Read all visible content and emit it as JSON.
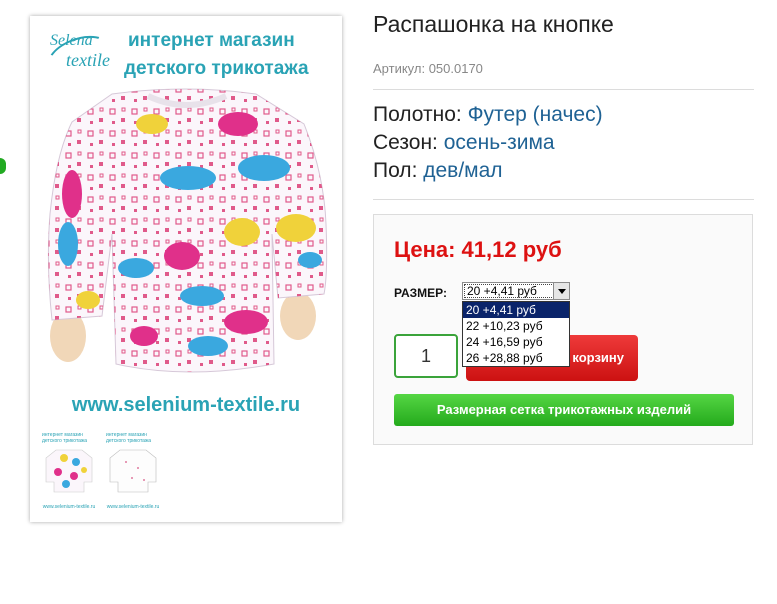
{
  "product": {
    "title": "Распашонка на кнопке",
    "sku": "Артикул: 050.0170"
  },
  "attributes": [
    {
      "label": "Полотно:",
      "value": "Футер (начес)"
    },
    {
      "label": "Сезон:",
      "value": "осень-зима"
    },
    {
      "label": "Пол:",
      "value": "дев/мал"
    }
  ],
  "image": {
    "brand_line1": "Selena",
    "brand_line2": "textile",
    "shop_line1": "интернет магазин",
    "shop_line2": "детского трикотажа",
    "site_url": "www.selenium-textile.ru",
    "thumb_head_line1": "интернет магазин",
    "thumb_head_line2": "детского трикотажа",
    "thumb_url": "www.selenium-textile.ru"
  },
  "buy": {
    "price": "Цена: 41,12 руб",
    "size_label": "РАЗМЕР:",
    "size_selected": "20 +4,41 руб",
    "size_options": [
      "20 +4,41 руб",
      "22 +10,23 руб",
      "24 +16,59 руб",
      "26 +28,88 руб"
    ],
    "quantity": "1",
    "cart_label": "корзину",
    "size_chart_label": "Размерная сетка трикотажных изделий"
  },
  "colors": {
    "accent_teal": "#2aa3b5",
    "price_red": "#dd1111",
    "link_blue": "#1f6294",
    "button_green": "#24aa1c",
    "button_red": "#cc1111"
  }
}
